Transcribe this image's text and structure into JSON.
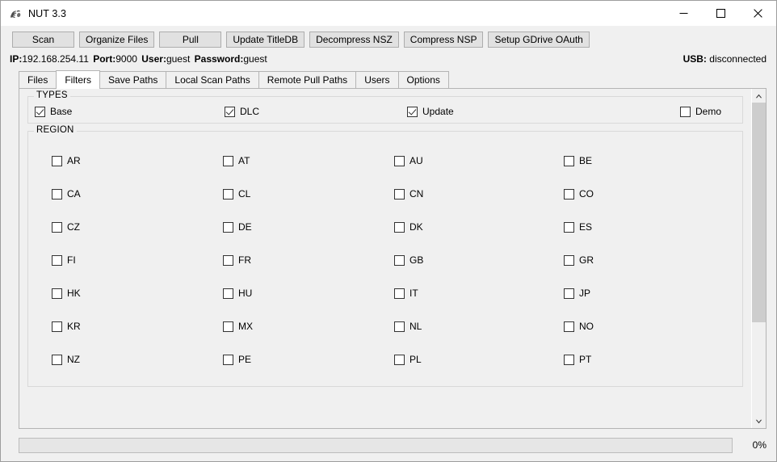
{
  "window": {
    "title": "NUT 3.3",
    "icon": "nut-app-icon",
    "controls": {
      "minimize": "minimize-icon",
      "maximize": "maximize-icon",
      "close": "close-icon"
    }
  },
  "toolbar": {
    "buttons": [
      {
        "label": "Scan",
        "name": "scan-button"
      },
      {
        "label": "Organize Files",
        "name": "organize-files-button"
      },
      {
        "label": "Pull",
        "name": "pull-button"
      },
      {
        "label": "Update TitleDB",
        "name": "update-titledb-button"
      },
      {
        "label": "Decompress NSZ",
        "name": "decompress-nsz-button"
      },
      {
        "label": "Compress NSP",
        "name": "compress-nsp-button"
      },
      {
        "label": "Setup GDrive OAuth",
        "name": "setup-gdrive-oauth-button"
      }
    ]
  },
  "status": {
    "ip_label": "IP:",
    "ip_value": "192.168.254.11",
    "port_label": "Port:",
    "port_value": "9000",
    "user_label": "User:",
    "user_value": "guest",
    "password_label": "Password:",
    "password_value": "guest",
    "usb_label": "USB:",
    "usb_value": "disconnected"
  },
  "tabs": [
    {
      "label": "Files",
      "active": false
    },
    {
      "label": "Filters",
      "active": true
    },
    {
      "label": "Save Paths",
      "active": false
    },
    {
      "label": "Local Scan Paths",
      "active": false
    },
    {
      "label": "Remote Pull Paths",
      "active": false
    },
    {
      "label": "Users",
      "active": false
    },
    {
      "label": "Options",
      "active": false
    }
  ],
  "filters": {
    "types": {
      "title": "TYPES",
      "items": [
        {
          "label": "Base",
          "checked": true
        },
        {
          "label": "DLC",
          "checked": true
        },
        {
          "label": "Update",
          "checked": true
        },
        {
          "label": "Demo",
          "checked": false
        }
      ]
    },
    "region": {
      "title": "REGION",
      "items": [
        {
          "label": "AR",
          "checked": false
        },
        {
          "label": "AT",
          "checked": false
        },
        {
          "label": "AU",
          "checked": false
        },
        {
          "label": "BE",
          "checked": false
        },
        {
          "label": "CA",
          "checked": false
        },
        {
          "label": "CL",
          "checked": false
        },
        {
          "label": "CN",
          "checked": false
        },
        {
          "label": "CO",
          "checked": false
        },
        {
          "label": "CZ",
          "checked": false
        },
        {
          "label": "DE",
          "checked": false
        },
        {
          "label": "DK",
          "checked": false
        },
        {
          "label": "ES",
          "checked": false
        },
        {
          "label": "FI",
          "checked": false
        },
        {
          "label": "FR",
          "checked": false
        },
        {
          "label": "GB",
          "checked": false
        },
        {
          "label": "GR",
          "checked": false
        },
        {
          "label": "HK",
          "checked": false
        },
        {
          "label": "HU",
          "checked": false
        },
        {
          "label": "IT",
          "checked": false
        },
        {
          "label": "JP",
          "checked": false
        },
        {
          "label": "KR",
          "checked": false
        },
        {
          "label": "MX",
          "checked": false
        },
        {
          "label": "NL",
          "checked": false
        },
        {
          "label": "NO",
          "checked": false
        },
        {
          "label": "NZ",
          "checked": false
        },
        {
          "label": "PE",
          "checked": false
        },
        {
          "label": "PL",
          "checked": false
        },
        {
          "label": "PT",
          "checked": false
        }
      ],
      "clipped_row": [
        {
          "label": "",
          "checked": false
        },
        {
          "label": "",
          "checked": false
        },
        {
          "label": "",
          "checked": false
        },
        {
          "label": "",
          "checked": false
        }
      ]
    }
  },
  "scrollbar": {
    "up": "scroll-up-arrow-icon",
    "down": "scroll-down-arrow-icon",
    "thumb_position_percent": 0
  },
  "progress": {
    "percent_label": "0%",
    "value": 0
  },
  "colors": {
    "window_bg": "#f0f0f0",
    "titlebar_bg": "#ffffff",
    "button_face": "#e1e1e1",
    "button_border": "#adadad",
    "tab_active_bg": "#ffffff",
    "scroll_thumb": "#cdcdcd",
    "progress_bar": "#06b025",
    "text": "#000000"
  }
}
